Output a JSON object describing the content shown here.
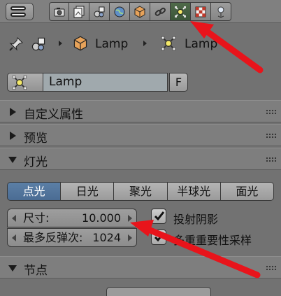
{
  "tabs": [
    {
      "name": "render-icon"
    },
    {
      "name": "render-layers-icon"
    },
    {
      "name": "scene-icon"
    },
    {
      "name": "world-icon"
    },
    {
      "name": "object-icon"
    },
    {
      "name": "constraints-icon"
    },
    {
      "name": "lamp-data-icon",
      "active": true
    },
    {
      "name": "texture-icon"
    },
    {
      "name": "particles-icon"
    }
  ],
  "breadcrumb": {
    "object": "Lamp",
    "data": "Lamp"
  },
  "datablock": {
    "name": "Lamp",
    "fake_user": "F"
  },
  "panels": {
    "custom_props": "自定义属性",
    "preview": "预览",
    "lamp": "灯光",
    "nodes": "节点"
  },
  "lamp_types": [
    "点光",
    "日光",
    "聚光",
    "半球光",
    "面光"
  ],
  "size": {
    "label": "尺寸:",
    "value": "10.000"
  },
  "bounces": {
    "label": "最多反弹次:",
    "value": "1024"
  },
  "cast_shadow": {
    "label": "投射阴影",
    "checked": true
  },
  "mis": {
    "label": "多重重要性采样",
    "checked": true
  },
  "colors": {
    "accent": "#5b7fa6",
    "active_tab": "#4f6a4a",
    "annotation": "#e8141b"
  }
}
